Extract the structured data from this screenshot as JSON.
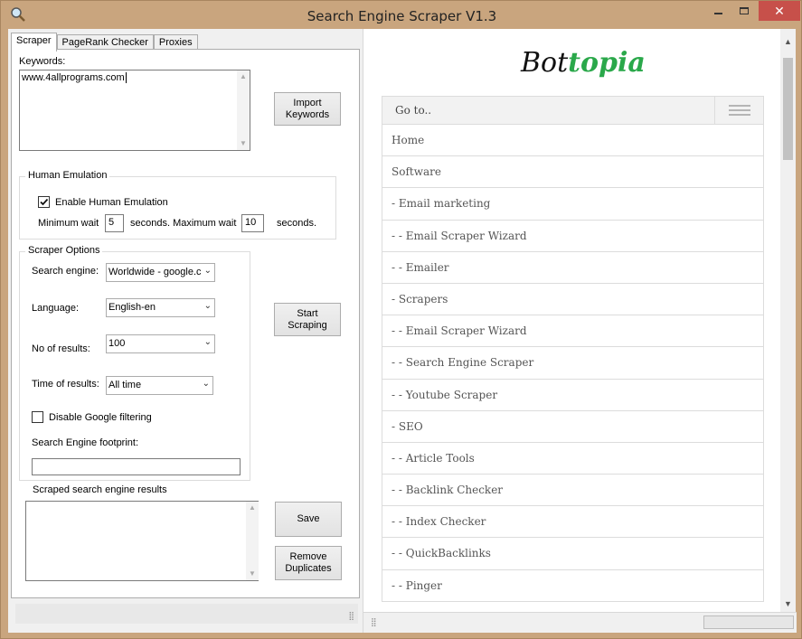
{
  "window": {
    "title": "Search Engine Scraper V1.3",
    "icon": "magnifier-icon"
  },
  "tabs": [
    {
      "label": "Scraper",
      "active": true
    },
    {
      "label": "PageRank Checker",
      "active": false
    },
    {
      "label": "Proxies",
      "active": false
    }
  ],
  "keywords": {
    "label": "Keywords:",
    "value": "www.4allprograms.com"
  },
  "import_button": "Import\nKeywords",
  "human_emulation": {
    "title": "Human Emulation",
    "enable_label": "Enable Human Emulation",
    "enabled": true,
    "min_label": "Minimum wait",
    "min_value": "5",
    "mid_label": "seconds. Maximum wait",
    "max_value": "10",
    "end_label": "seconds."
  },
  "scraper_options": {
    "title": "Scraper Options",
    "search_engine_label": "Search engine:",
    "search_engine_value": "Worldwide - google.c",
    "language_label": "Language:",
    "language_value": "English-en",
    "results_label": "No of results:",
    "results_value": "100",
    "time_label": "Time of results:",
    "time_value": "All time",
    "disable_filter_label": "Disable Google filtering",
    "disable_filter": false,
    "footprint_label": "Search Engine footprint:",
    "footprint_value": ""
  },
  "start_button": "Start\nScraping",
  "results": {
    "label": "Scraped search engine results",
    "value": ""
  },
  "save_button": "Save",
  "remove_dup_button": "Remove\nDuplicates",
  "site": {
    "logo_part1": "Bot",
    "logo_part2": "topia",
    "goto_label": "Go to..",
    "nav_items": [
      "Home",
      "Software",
      "- Email marketing",
      "- - Email Scraper Wizard",
      "- - Emailer",
      "- Scrapers",
      "- - Email Scraper Wizard",
      "- - Search Engine Scraper",
      "- - Youtube Scraper",
      "- SEO",
      "- - Article Tools",
      "- - Backlink Checker",
      "- - Index Checker",
      "- - QuickBacklinks",
      "- - Pinger"
    ]
  }
}
